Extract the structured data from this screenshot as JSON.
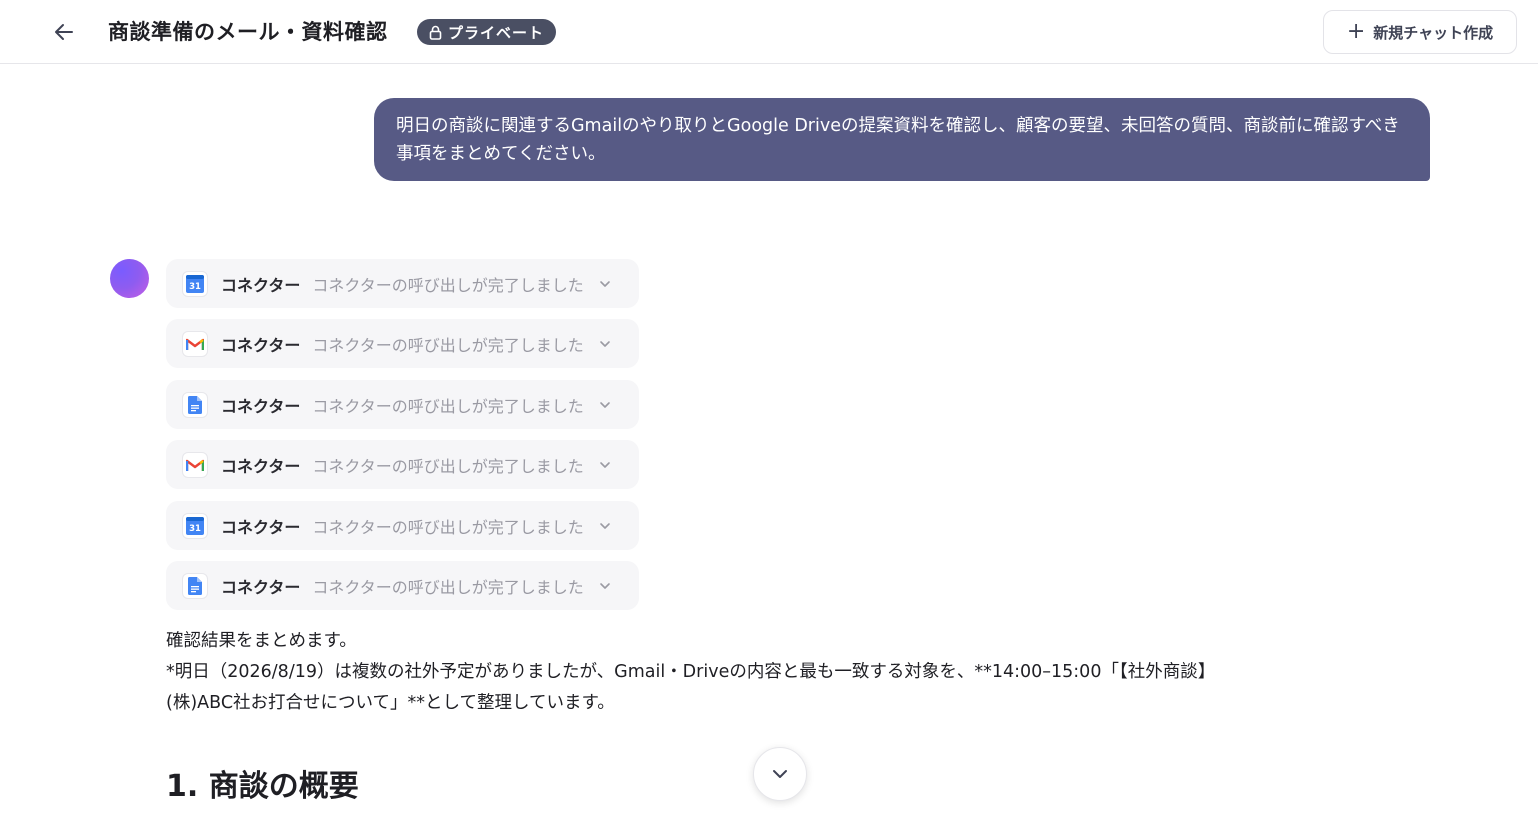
{
  "header": {
    "title": "商談準備のメール・資料確認",
    "badge_label": "プライベート",
    "new_chat_label": "新規チャット作成"
  },
  "user_message": "明日の商談に関連するGmailのやり取りとGoogle Driveの提案資料を確認し、顧客の要望、未回答の質問、商談前に確認すべき事項をまとめてください。",
  "connectors": [
    {
      "icon": "google-calendar-icon",
      "label": "コネクター",
      "status": "コネクターの呼び出しが完了しました"
    },
    {
      "icon": "gmail-icon",
      "label": "コネクター",
      "status": "コネクターの呼び出しが完了しました"
    },
    {
      "icon": "google-docs-icon",
      "label": "コネクター",
      "status": "コネクターの呼び出しが完了しました"
    },
    {
      "icon": "gmail-icon",
      "label": "コネクター",
      "status": "コネクターの呼び出しが完了しました"
    },
    {
      "icon": "google-calendar-icon",
      "label": "コネクター",
      "status": "コネクターの呼び出しが完了しました"
    },
    {
      "icon": "google-docs-icon",
      "label": "コネクター",
      "status": "コネクターの呼び出しが完了しました"
    }
  ],
  "calendar_icon_text": "31",
  "answer": {
    "line1": "確認結果をまとめます。",
    "line2": "*明日（2026/8/19）は複数の社外予定がありましたが、Gmail・Driveの内容と最も一致する対象を、**14:00–15:00「【社外商談】",
    "line3": "(株)ABC社お打合せについて」**として整理しています。",
    "section_heading": "1. 商談の概要"
  },
  "colors": {
    "user_bubble": "#575a85",
    "badge": "#4a4f63",
    "connector_bg": "#f6f6f8"
  }
}
